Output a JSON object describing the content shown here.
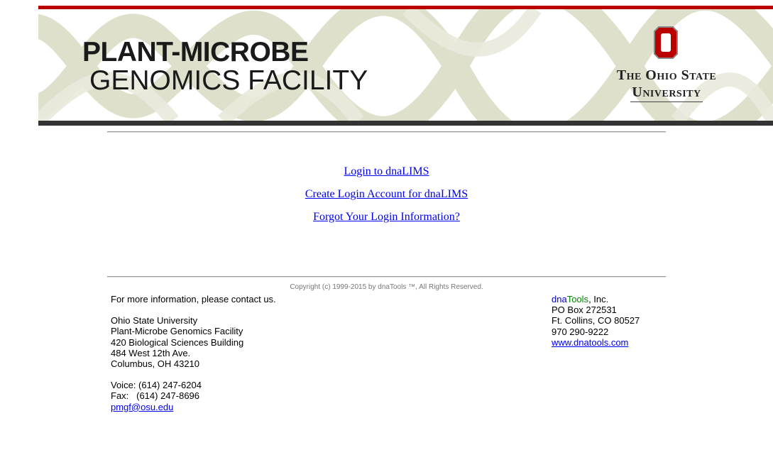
{
  "banner": {
    "title_line1": "PLANT-MICROBE",
    "title_line2": "GENOMICS FACILITY",
    "university_line1": "The Ohio State",
    "university_line2": "University",
    "accent_red": "#bb0000",
    "helix_color": "#dedfc9"
  },
  "links": {
    "login": "Login to dnaLIMS",
    "create_account": "Create Login Account for dnaLIMS",
    "forgot": "Forgot Your Login Information?"
  },
  "footer": {
    "copyright": "Copyright (c) 1999-2015 by dnaTools ™, All Rights Reserved.",
    "contact_intro": "For more information, please contact us.",
    "address": [
      "Ohio State University",
      "Plant-Microbe Genomics Facility",
      "420 Biological Sciences Building",
      "484 West 12th Ave.",
      "Columbus, OH 43210"
    ],
    "voice": "Voice: (614) 247-6204",
    "fax": "Fax:   (614) 247-8696",
    "email": "pmgf@osu.edu",
    "vendor": {
      "name_part1": "dna",
      "name_part2": "Tools",
      "name_part3": ", Inc.",
      "po_box": "PO Box 272531",
      "city": "Ft. Collins, CO 80527",
      "phone": "970 290-9222",
      "website": "www.dnatools.com"
    }
  }
}
